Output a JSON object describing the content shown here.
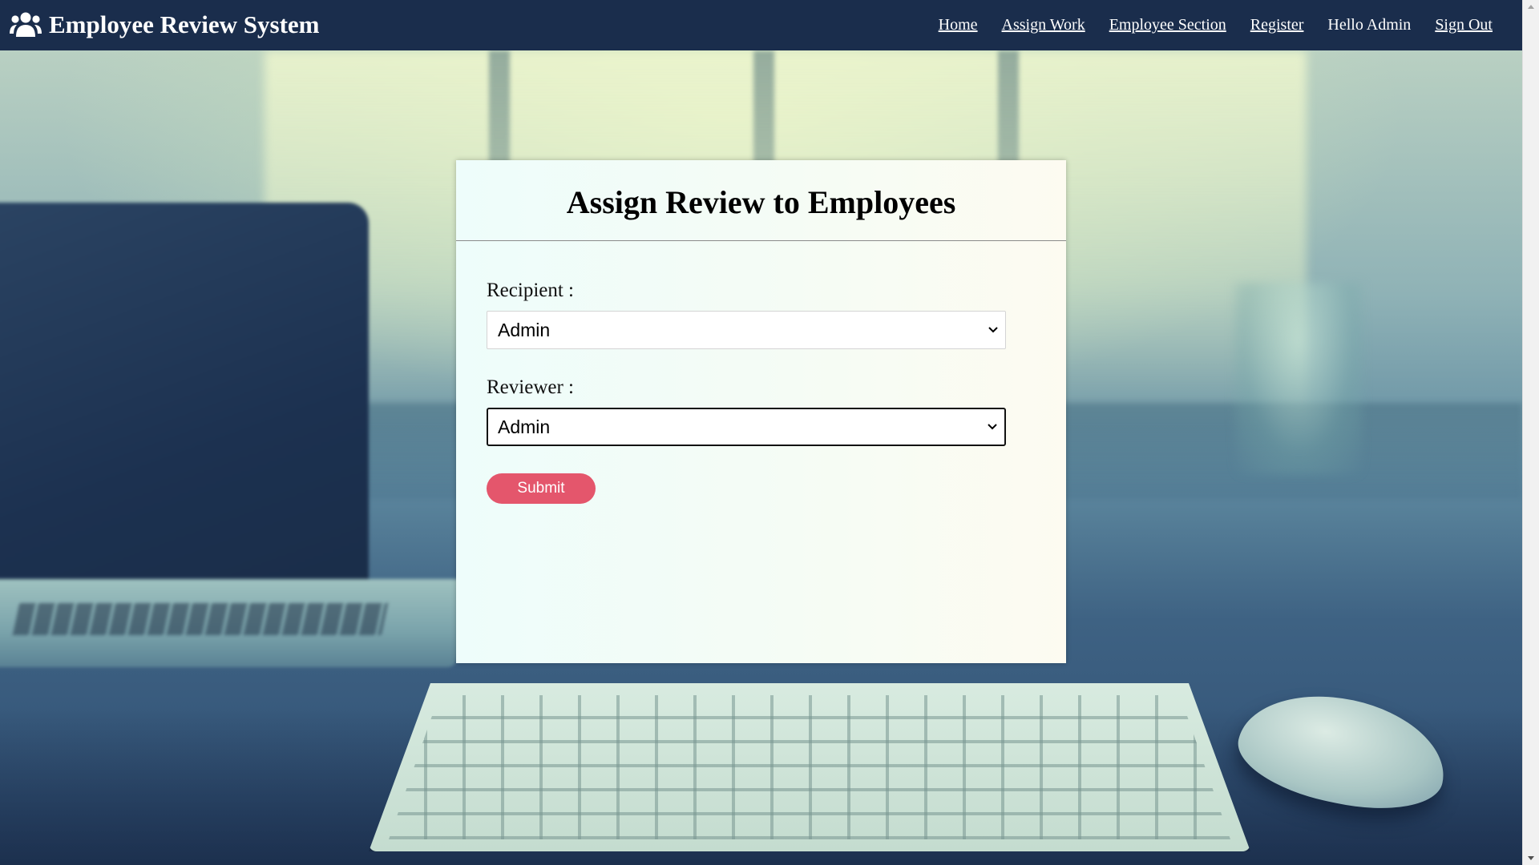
{
  "app": {
    "title": "Employee Review System",
    "icon": "users-icon"
  },
  "nav": {
    "home": "Home",
    "assign_work": "Assign Work",
    "employee_section": "Employee Section",
    "register": "Register",
    "greeting": "Hello Admin",
    "sign_out": "Sign Out"
  },
  "form": {
    "title": "Assign Review to Employees",
    "recipient_label": "Recipient :",
    "recipient_value": "Admin",
    "reviewer_label": "Reviewer :",
    "reviewer_value": "Admin",
    "submit_label": "Submit"
  },
  "colors": {
    "navbar": "#1a2d4c",
    "submit_button": "#e4566c",
    "card_background": "#f5fcf5"
  }
}
